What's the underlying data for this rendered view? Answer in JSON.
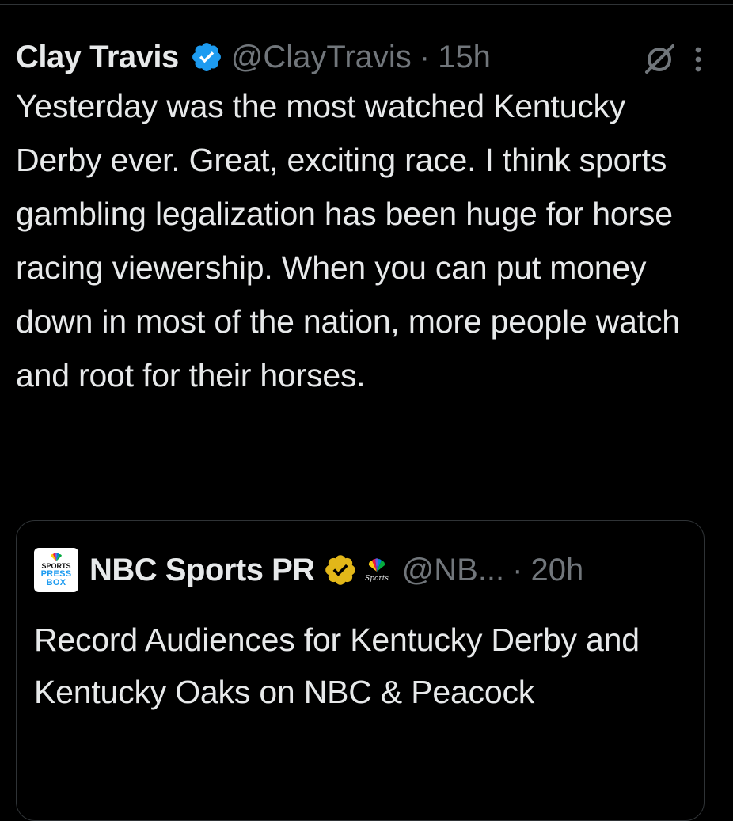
{
  "tweet": {
    "display_name": "Clay Travis",
    "handle": "@ClayTravis",
    "separator": "·",
    "time": "15h",
    "text": "Yesterday was the most watched Kentucky Derby ever. Great, exciting race. I think sports gambling legalization has been huge for horse racing viewership. When you can put money down in most of the nation, more people watch and root for their horses."
  },
  "quote": {
    "avatar_lines": [
      "SPORTS",
      "PRESS",
      "BOX"
    ],
    "display_name": "NBC Sports PR",
    "affiliate_label": "Sports",
    "handle": "@NB...",
    "separator": "·",
    "time": "20h",
    "text": "Record Audiences for Kentucky Derby and Kentucky Oaks on NBC & Peacock"
  },
  "colors": {
    "background": "#000000",
    "text_primary": "#e7e9ea",
    "text_secondary": "#71767b",
    "verified_blue": "#1d9bf0",
    "verified_gold": "#e2b719",
    "border": "#2f3336"
  },
  "icons": {
    "verified": "verified-blue-badge-icon",
    "grok": "grok-icon",
    "more": "more-options-icon",
    "gold_verified": "verified-gold-badge-icon",
    "affiliate": "nbc-sports-affiliate-icon"
  }
}
